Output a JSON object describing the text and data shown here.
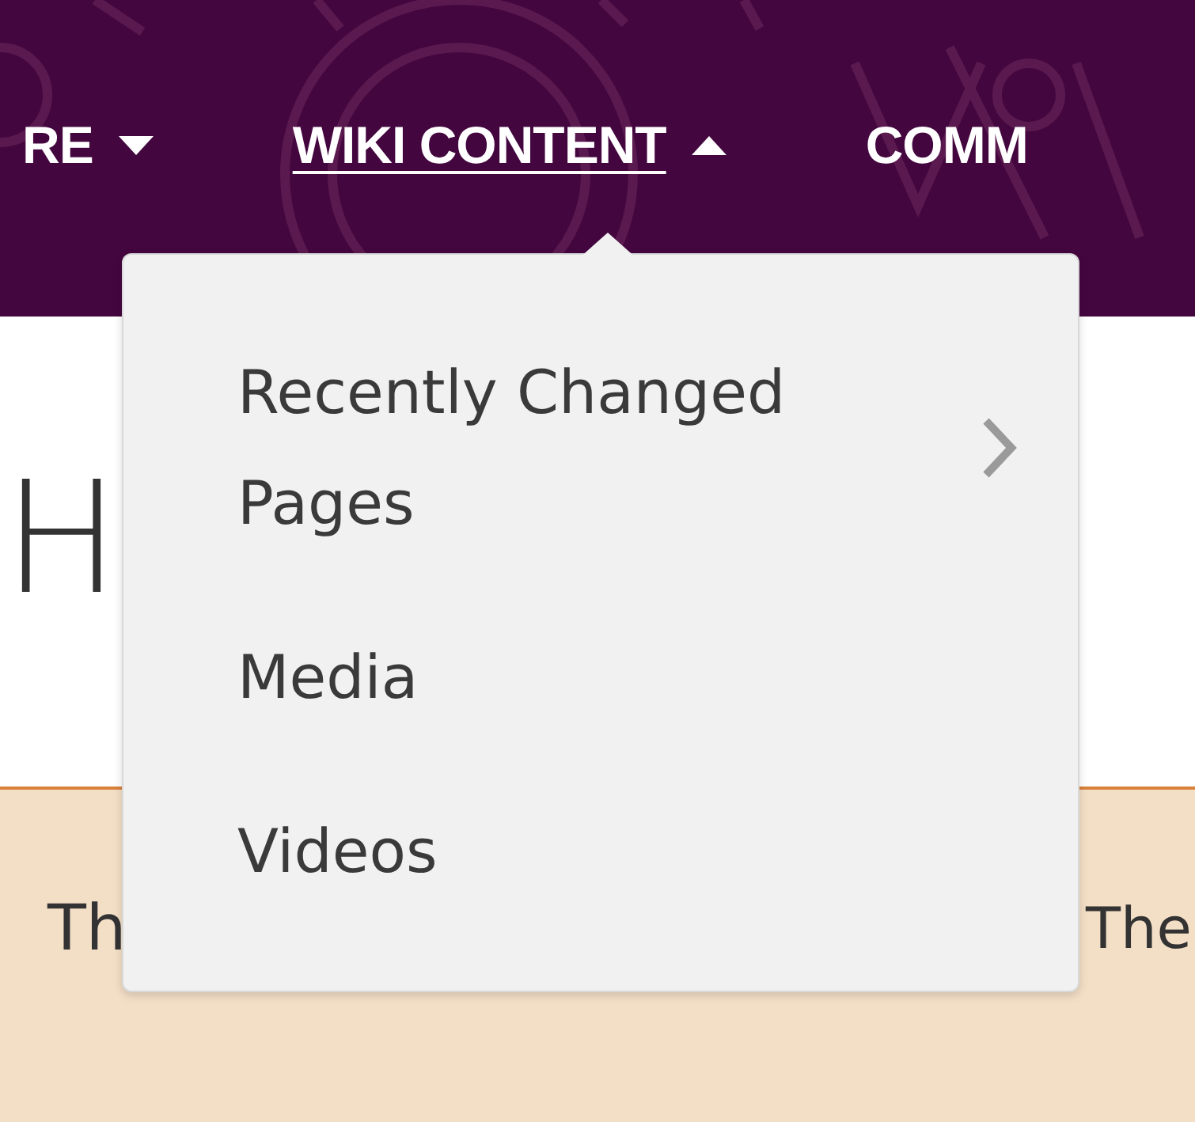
{
  "nav": {
    "items": [
      {
        "label": "RE",
        "dropdown": true,
        "expanded": false,
        "selected": false
      },
      {
        "label": "WIKI CONTENT",
        "dropdown": true,
        "expanded": true,
        "selected": true
      },
      {
        "label": "COMM",
        "dropdown": false,
        "selected": false
      }
    ]
  },
  "dropdown_menu": {
    "items": [
      {
        "label": "Recently Changed Pages",
        "has_submenu": true
      },
      {
        "label": "Media",
        "has_submenu": false
      },
      {
        "label": "Videos",
        "has_submenu": false
      }
    ]
  },
  "page": {
    "heading": "H",
    "notice": {
      "text_left": "Th",
      "text_right": "The"
    }
  }
}
